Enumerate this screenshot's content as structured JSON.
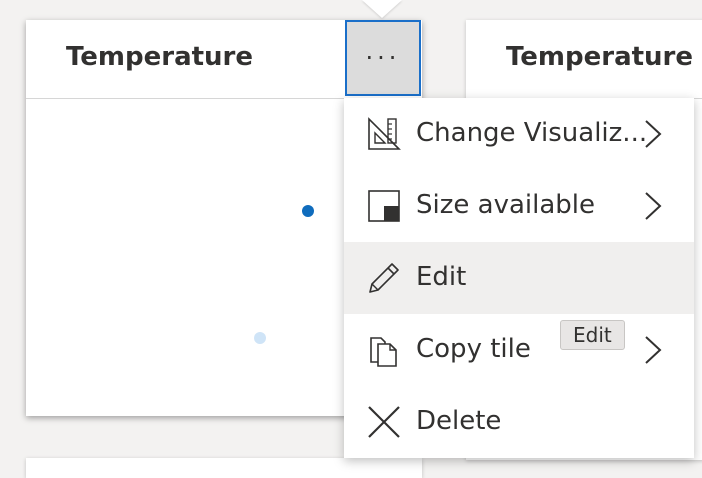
{
  "tiles": {
    "left_title": "Temperature",
    "right_title": "Temperature",
    "more_label": "···"
  },
  "menu": {
    "items": [
      {
        "label": "Change Visualiz...",
        "icon": "ruler-triangle-icon",
        "has_submenu": true
      },
      {
        "label": "Size available",
        "icon": "size-box-icon",
        "has_submenu": true
      },
      {
        "label": "Edit",
        "icon": "pencil-icon",
        "has_submenu": false
      },
      {
        "label": "Copy tile",
        "icon": "copy-icon",
        "has_submenu": true
      },
      {
        "label": "Delete",
        "icon": "close-icon",
        "has_submenu": false
      }
    ]
  },
  "tooltip": {
    "text": "Edit"
  },
  "colors": {
    "accent": "#1a6fc9",
    "dot_dark": "#0f6cbd",
    "dot_light": "#cfe4f7",
    "hover_bg": "#f0efee"
  }
}
